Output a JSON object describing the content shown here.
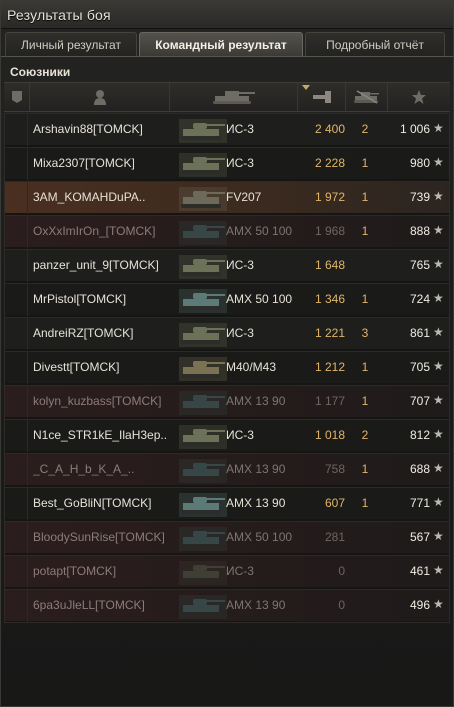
{
  "window": {
    "title": "Результаты боя"
  },
  "tabs": [
    {
      "label": "Личный результат",
      "active": false
    },
    {
      "label": "Командный результат",
      "active": true
    },
    {
      "label": "Подробный отчёт",
      "active": false
    }
  ],
  "team": {
    "label": "Союзники"
  },
  "columns": [
    {
      "id": "squad",
      "icon": "squad-icon"
    },
    {
      "id": "player",
      "icon": "player-icon"
    },
    {
      "id": "tank",
      "icon": "tank-icon"
    },
    {
      "id": "damage",
      "icon": "damage-icon",
      "sorted": true
    },
    {
      "id": "frags",
      "icon": "frags-icon"
    },
    {
      "id": "xp",
      "icon": "star-icon"
    }
  ],
  "rows": [
    {
      "name": "Arshavin88[TOMCK]",
      "tank": "ИС-3",
      "damage": "2 400",
      "frags": "2",
      "xp": "1 006",
      "status": "alive",
      "tank_color": "#6b7258"
    },
    {
      "name": "Mixa2307[TOMCK]",
      "tank": "ИС-3",
      "damage": "2 228",
      "frags": "1",
      "xp": "980",
      "status": "alive",
      "tank_color": "#6b7258"
    },
    {
      "name": "3AM_KOMAHDuPA..",
      "tank": "FV207",
      "damage": "1 972",
      "frags": "1",
      "xp": "739",
      "status": "player",
      "tank_color": "#6d6a5a"
    },
    {
      "name": "OxXxImIrOn_[TOMCK]",
      "tank": "AMX 50 100",
      "damage": "1 968",
      "frags": "1",
      "xp": "888",
      "status": "dead",
      "tank_color": "#3f5a5a"
    },
    {
      "name": "panzer_unit_9[TOMCK]",
      "tank": "ИС-3",
      "damage": "1 648",
      "frags": "",
      "xp": "765",
      "status": "alive",
      "tank_color": "#6b7258"
    },
    {
      "name": "MrPistol[TOMCK]",
      "tank": "AMX 50 100",
      "damage": "1 346",
      "frags": "1",
      "xp": "724",
      "status": "alive",
      "tank_color": "#5b7a78"
    },
    {
      "name": "AndreiRZ[TOMCK]",
      "tank": "ИС-3",
      "damage": "1 221",
      "frags": "3",
      "xp": "861",
      "status": "alive",
      "tank_color": "#6b7258"
    },
    {
      "name": "Divestt[TOMCK]",
      "tank": "M40/M43",
      "damage": "1 212",
      "frags": "1",
      "xp": "705",
      "status": "alive",
      "tank_color": "#7a7252"
    },
    {
      "name": "kolyn_kuzbass[TOMCK]",
      "tank": "AMX 13 90",
      "damage": "1 177",
      "frags": "1",
      "xp": "707",
      "status": "dead",
      "tank_color": "#3f5a5a"
    },
    {
      "name": "N1ce_STR1kE_IlaH3ep..",
      "tank": "ИС-3",
      "damage": "1 018",
      "frags": "2",
      "xp": "812",
      "status": "alive",
      "tank_color": "#6b7258"
    },
    {
      "name": "_C_A_H_b_K_A_..",
      "tank": "AMX 13 90",
      "damage": "758",
      "frags": "1",
      "xp": "688",
      "status": "dead",
      "tank_color": "#3f5a5a"
    },
    {
      "name": "Best_GoBliN[TOMCK]",
      "tank": "AMX 13 90",
      "damage": "607",
      "frags": "1",
      "xp": "771",
      "status": "alive",
      "tank_color": "#5b7a78"
    },
    {
      "name": "BloodySunRise[TOMCK]",
      "tank": "AMX 50 100",
      "damage": "281",
      "frags": "",
      "xp": "567",
      "status": "dead",
      "tank_color": "#3f5a5a"
    },
    {
      "name": "potapt[TOMCK]",
      "tank": "ИС-3",
      "damage": "0",
      "frags": "",
      "xp": "461",
      "status": "dead",
      "tank_color": "#4a4f40"
    },
    {
      "name": "6pa3uJleLL[TOMCK]",
      "tank": "AMX 13 90",
      "damage": "0",
      "frags": "",
      "xp": "496",
      "status": "dead",
      "tank_color": "#3f5a5a"
    }
  ],
  "colors": {
    "damage": "#e0b56a",
    "dead_name": "#8f7b7b",
    "player_row": "#4a2f20"
  }
}
